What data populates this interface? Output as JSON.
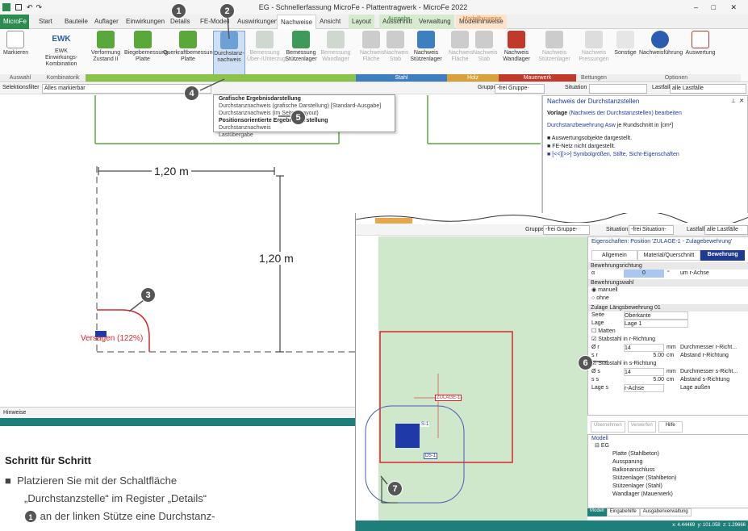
{
  "window": {
    "title": "EG - Schnellerfassung MicroFe - Plattentragwerk - MicroFe 2022"
  },
  "tabs": [
    "MicroFe",
    "Start",
    "Bauteile",
    "Auflager",
    "Einwirkungen",
    "Details",
    "FE-Modell",
    "Auswirkungen",
    "Nachweise",
    "Ansicht",
    "Layout",
    "Ausschnitt",
    "Verwaltung",
    "Modellhinweise"
  ],
  "context_headers": {
    "ausgabe": "Ausgabe",
    "modellhinweise": "Modellhinweise"
  },
  "ribbon": {
    "buttons": [
      "Markieren",
      "EWK Einwirkungs-Kombination",
      "Verformung Zustand II",
      "Biegebemessung Platte",
      "Querkraftbemessung Platte",
      "Durchstanz-nachweis",
      "Bemessung Über-/Unterzug",
      "Bemessung Stützenlager",
      "Bemessung Wandlager",
      "Nachweis Fläche",
      "Nachweis Stab",
      "Nachweis Stützenlager",
      "Nachweis Fläche",
      "Nachweis Stab",
      "Nachweis Wandlager",
      "Nachweis Stützenlager",
      "Nachweis Pressungen",
      "Sonstige",
      "Nachweisführung",
      "Auswertung"
    ],
    "groups": [
      "Auswahl",
      "Kombinatorik",
      "Stahl",
      "Holz",
      "Mauerwerk",
      "Bettungen",
      "Optionen"
    ]
  },
  "filterbar": {
    "label": "Selektionsfilter",
    "value": "Alles markierbar",
    "gruppe_label": "Gruppe",
    "gruppe_value": "-frei Gruppe-",
    "situation_label": "Situation",
    "lastfall_label": "Lastfall",
    "lastfall_value": "alle Lastfälle"
  },
  "dropdown": {
    "items": [
      "Grafische Ergebnisdarstellung",
      "Durchstanznachweis (grafische Darstellung) [Standard-Ausgabe]",
      "Durchstanznachweis (im Seiten-Layout)",
      "Positionsorientierte Ergebnisdarstellung",
      "Durchstanznachweis",
      "Lastübergabe"
    ]
  },
  "canvas": {
    "dim_h": "1,20 m",
    "dim_v": "1,20 m",
    "failure": "Versagen (122%)",
    "hinweise_tab": "Hinweise"
  },
  "info_panel": {
    "title": "Nachweis der Durchstanzstellen",
    "vorlage": "Vorlage",
    "vorlage_link": "Nachweis der Durchstanzstellen",
    "vorlage_action": "bearbeiten",
    "line1_link": "Durchstanzbewehrung Asw",
    "line1_rest": "je Rundschnitt in [cm²]",
    "bullets": [
      "Auswertungsobjekte dargestellt.",
      "FE-Netz nicht dargestellt.",
      "[<<][>>] Symbolgrößen, Stifte, Sicht-Eigenschaften"
    ]
  },
  "overlay": {
    "gruppe": "-frei Gruppe-",
    "situation": "-frei Situation-",
    "lastfall": "alle Lastfälle",
    "labels": {
      "situation": "Situation",
      "lastfall": "Lastfall",
      "gruppe": "Gruppe"
    },
    "prop_title": "Eigenschaften: Position 'ZULAGE-1 - Zulagebewehrung'",
    "prop_tabs": [
      "Allgemein",
      "Material/Querschnitt",
      "Bewehrung"
    ],
    "sections": {
      "richtung": "Bewehrungsrichtung",
      "alpha_label": "α",
      "alpha_value": "0",
      "alpha_unit": "°",
      "alpha_desc": "um r-Achse",
      "wahl": "Bewehrungswahl",
      "manuell": "manuell",
      "ohne": "ohne",
      "zulage": "Zulage Längsbewehrung 01",
      "seite_label": "Seite",
      "seite_value": "Oberkante",
      "lage_label": "Lage",
      "lage_value": "Lage 1",
      "matten": "Matten",
      "stab_r": "Stabstahl in r-Richtung",
      "phi_r": "14",
      "phi_r_desc": "Durchmesser r-Richt...",
      "s_r": "5.00",
      "s_r_desc": "Abstand r-Richtung",
      "stab_s": "Stabstahl in s-Richtung",
      "phi_s": "14",
      "phi_s_desc": "Durchmesser s-Richt...",
      "s_s": "5.00",
      "s_s_desc": "Abstand s-Richtung",
      "lage_s_label": "Lage s",
      "lage_s_value": "r-Achse",
      "lage_s_desc": "Lage außen",
      "mm": "mm",
      "cm": "cm"
    },
    "buttons": [
      "Übernehmen",
      "Verwerfen",
      "Hilfe"
    ],
    "model": {
      "title": "Modell",
      "root": "EG",
      "items": [
        "Platte (Stahlbeton)",
        "Aussparung",
        "Balkonanschluss",
        "Stützenlager (Stahlbeton)",
        "Stützenlager (Stahl)",
        "Wandlager (Mauerwerk)"
      ],
      "tabs": [
        "Modell",
        "Eingabehilfe",
        "Ausgabenverwaltung"
      ]
    },
    "labels_canvas": [
      "ZULAGE-1",
      "D5-1",
      "S-1"
    ],
    "status": [
      "x: 4.44469",
      "y: 101.058",
      "z: 1.29666"
    ]
  },
  "badges": [
    "1",
    "2",
    "3",
    "4",
    "5",
    "6",
    "7"
  ],
  "steps": {
    "heading": "Schritt für Schritt",
    "text_1": "Platzieren Sie mit der Schaltfläche",
    "text_2": "„Durchstanzstelle“ im Register „Details“",
    "text_3": "an der linken Stütze eine Durchstanz-"
  },
  "colors": {
    "green": "#2e8b4f",
    "teal": "#1e7f7a",
    "red": "#d9262b",
    "blue": "#1f3aa8"
  }
}
